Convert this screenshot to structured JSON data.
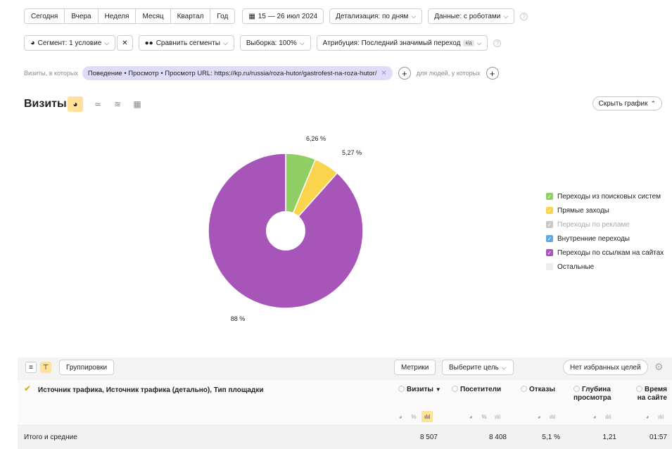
{
  "toolbar": {
    "periods": [
      "Сегодня",
      "Вчера",
      "Неделя",
      "Месяц",
      "Квартал",
      "Год"
    ],
    "date_range": "15 — 26 июл 2024",
    "detail": "Детализация: по дням",
    "data_filter": "Данные: с роботами",
    "segment": "Сегмент: 1 условие",
    "compare": "Сравнить сегменты",
    "sample": "Выборка: 100%",
    "attribution": "Атрибуция: Последний значимый переход",
    "attribution_badge": "к/д"
  },
  "filter": {
    "prefix": "Визиты, в которых",
    "condition": "Поведение • Просмотр • Просмотр URL: https://kp.ru/russia/roza-hutor/gastrofest-na-roza-hutor/",
    "people_label": "для людей, у которых"
  },
  "chart_header": {
    "title": "Визиты",
    "hide_button": "Скрыть график"
  },
  "chart_data": {
    "type": "pie",
    "labels": [
      "Переходы из поисковых систем",
      "Прямые заходы",
      "Переходы по ссылкам на сайтах"
    ],
    "values": [
      6.26,
      5.27,
      88
    ],
    "value_labels": [
      "6,26 %",
      "5,27 %",
      "88 %"
    ],
    "colors": [
      "#8fcf63",
      "#fbd44e",
      "#a855b9"
    ],
    "legend": [
      {
        "label": "Переходы из поисковых систем",
        "color": "#8fcf63",
        "enabled": true
      },
      {
        "label": "Прямые заходы",
        "color": "#fbd44e",
        "enabled": true
      },
      {
        "label": "Переходы по рекламе",
        "color": "#c9c9c9",
        "enabled": false
      },
      {
        "label": "Внутренние переходы",
        "color": "#5ea8e6",
        "enabled": true
      },
      {
        "label": "Переходы по ссылкам на сайтах",
        "color": "#a855b9",
        "enabled": true
      },
      {
        "label": "Остальные",
        "color": "#eeeeee",
        "enabled": false
      }
    ]
  },
  "table": {
    "groupings_button": "Группировки",
    "metrics_button": "Метрики",
    "goal_select": "Выберите цель",
    "favorites_button": "Нет избранных целей",
    "dimension_header": "Источник трафика, Источник трафика (детально), Тип площадки",
    "metrics": [
      "Визиты",
      "Посетители",
      "Отказы",
      "Глубина просмотра",
      "Время на сайте"
    ],
    "mini_icons": [
      "%",
      "ılıl"
    ],
    "total": {
      "label": "Итого и средние",
      "values": [
        "8 507",
        "8 408",
        "5,1 %",
        "1,21",
        "01:57"
      ]
    }
  },
  "icons": {
    "calendar": "calendar-icon",
    "pie": "pie-chart-icon",
    "line": "line-chart-icon",
    "area": "area-chart-icon",
    "bar": "bar-chart-icon",
    "gear": "gear-icon"
  }
}
